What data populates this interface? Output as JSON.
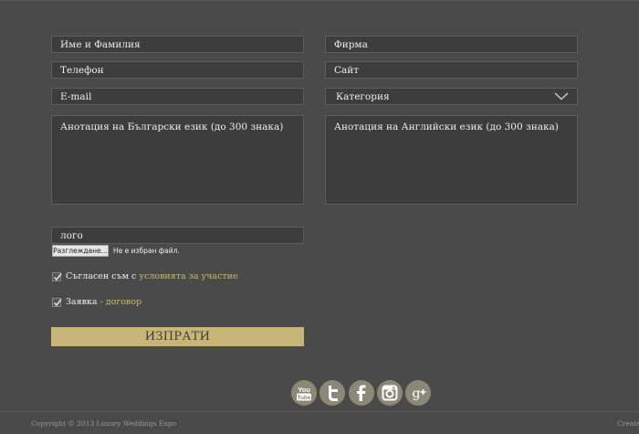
{
  "form": {
    "name_placeholder": "Име и Фамилия",
    "company_placeholder": "Фирма",
    "phone_placeholder": "Телефон",
    "site_placeholder": "Сайт",
    "email_placeholder": "E-mail",
    "category_label": "Категория",
    "annotation_bg_placeholder": "Анотация на Български език (до 300 знака)",
    "annotation_en_placeholder": "Анотация на Английски език (до 300 знака)",
    "logo_label": "лого",
    "file_button": "Разглеждане...",
    "file_status": "Не е избран файл.",
    "agree_text": "Съгласен съм с ",
    "agree_link": "условията за участие",
    "application_text": "Заявка ",
    "application_link": "- договор",
    "submit_label": "ИЗПРАТИ"
  },
  "social": {
    "icons": [
      "youtube-icon",
      "twitter-icon",
      "facebook-icon",
      "instagram-icon",
      "google-plus-icon"
    ],
    "youtube_text": "You Tube"
  },
  "footer": {
    "copyright": "Copyright © 2013 Luxury Weddings Expo",
    "created": "Created"
  },
  "colors": {
    "background": "#4b4a4b",
    "field_bg": "#3e3d3e",
    "accent": "#c8b679",
    "social_bg": "#8b8878"
  }
}
